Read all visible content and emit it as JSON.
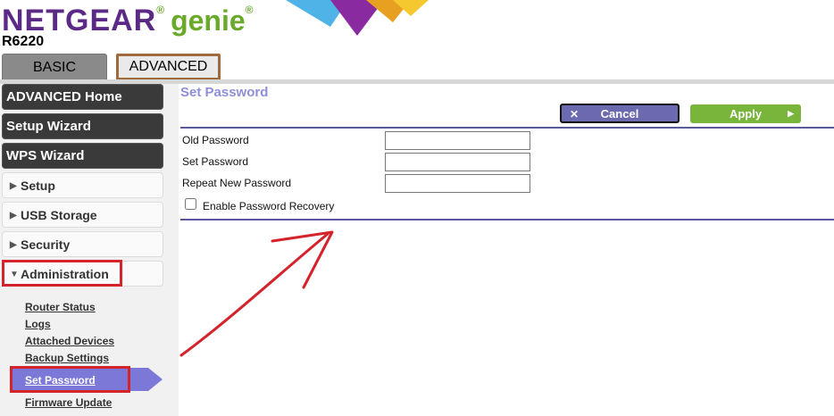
{
  "header": {
    "brand": "NETGEAR",
    "brand_suffix": "genie",
    "trademark": "®",
    "model": "R6220"
  },
  "tabs": [
    {
      "label": "BASIC"
    },
    {
      "label": "ADVANCED"
    }
  ],
  "sidebar": {
    "main_items": [
      {
        "label": "ADVANCED Home"
      },
      {
        "label": "Setup Wizard"
      },
      {
        "label": "WPS Wizard"
      }
    ],
    "sections": [
      {
        "label": "Setup"
      },
      {
        "label": "USB Storage"
      },
      {
        "label": "Security"
      },
      {
        "label": "Administration"
      }
    ],
    "admin_links": [
      {
        "label": "Router Status"
      },
      {
        "label": "Logs"
      },
      {
        "label": "Attached Devices"
      },
      {
        "label": "Backup Settings"
      },
      {
        "label": "Set Password"
      },
      {
        "label": "Firmware Update"
      }
    ]
  },
  "main": {
    "title": "Set Password",
    "cancel_label": "Cancel",
    "apply_label": "Apply",
    "fields": [
      {
        "label": "Old Password",
        "value": ""
      },
      {
        "label": "Set Password",
        "value": ""
      },
      {
        "label": "Repeat New Password",
        "value": ""
      }
    ],
    "recovery_label": "Enable Password Recovery",
    "recovery_checked": false
  },
  "colors": {
    "brand_purple": "#5b2a86",
    "brand_green": "#6aaa2a",
    "highlight_red": "#d4232a",
    "selected_purple": "#7b78d8",
    "apply_green": "#79b53a",
    "cancel_purple": "#6b6ab0"
  }
}
